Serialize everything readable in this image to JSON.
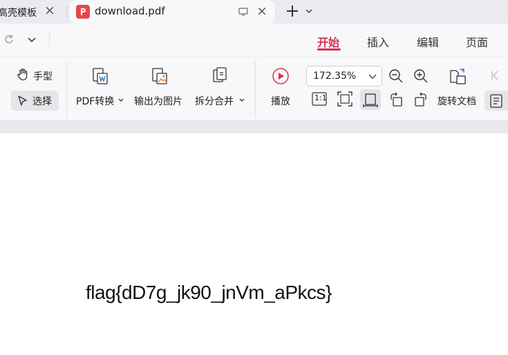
{
  "tabs": {
    "previous": {
      "label": "高壳模板"
    },
    "active": {
      "label": "download.pdf"
    }
  },
  "ribbon_tabs": [
    {
      "label": "开始",
      "active": true
    },
    {
      "label": "插入",
      "active": false
    },
    {
      "label": "编辑",
      "active": false
    },
    {
      "label": "页面",
      "active": false
    }
  ],
  "toolbar": {
    "hand_label": "手型",
    "select_label": "选择",
    "pdf_convert_label": "PDF转换",
    "export_image_label": "输出为图片",
    "split_merge_label": "拆分合并",
    "play_label": "播放",
    "zoom_value": "172.35%",
    "actual_size_label": "1:1",
    "rotate_doc_label": "旋转文档"
  },
  "document": {
    "text": "flag{dD7g_jk90_jnVm_aPkcs}"
  },
  "colors": {
    "accent": "#d9304f",
    "pdf_icon": "#e5484d"
  }
}
